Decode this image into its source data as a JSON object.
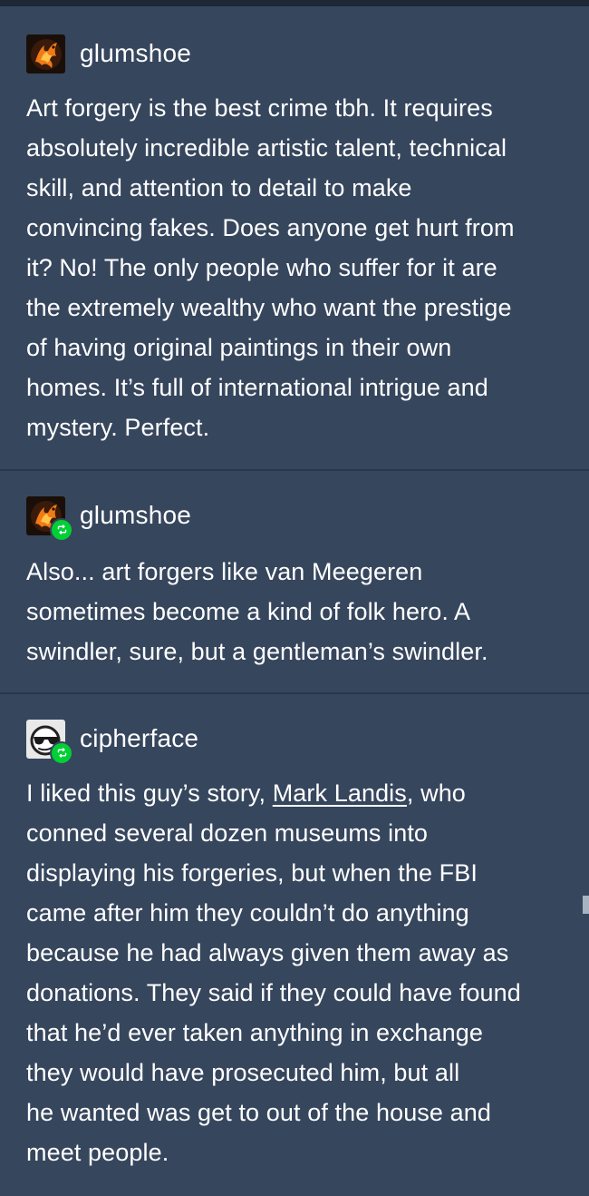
{
  "posts": [
    {
      "username": "glumshoe",
      "is_reblog": false,
      "avatar_icon": "fiery-phoenix-avatar",
      "lines": [
        "Art forgery is the best crime tbh. It requires",
        "absolutely incredible artistic talent, technical",
        "skill, and attention to detail to make",
        "convincing fakes. Does anyone get hurt from",
        "it? No! The only people who suffer for it are",
        "the extremely wealthy who want the prestige",
        "of having original paintings in their own",
        "homes. It’s full of international intrigue and",
        "mystery. Perfect."
      ]
    },
    {
      "username": "glumshoe",
      "is_reblog": true,
      "avatar_icon": "fiery-phoenix-avatar",
      "lines": [
        "Also... art forgers like van Meegeren",
        "sometimes become a kind of folk hero. A",
        "swindler, sure, but a gentleman’s swindler."
      ]
    },
    {
      "username": "cipherface",
      "is_reblog": true,
      "avatar_icon": "sunglasses-face-avatar",
      "lines": {
        "l1_before": "I liked this guy’s story, ",
        "l1_link": "Mark Landis",
        "l1_after": ", who",
        "l2": "conned several dozen museums into",
        "l3": "displaying his forgeries, but when the FBI",
        "l4": "came after him they couldn’t do anything",
        "l5": "because he had always given them away as",
        "l6": "donations. They said if they could have found",
        "l7": "that he’d ever taken anything in exchange",
        "l8": "they would have prosecuted him, but all",
        "l9": "he wanted was get to out of the house and",
        "l10": "meet people."
      }
    }
  ],
  "colors": {
    "background": "#36465d",
    "divider": "#2a3749",
    "reblog_badge": "#00cf35",
    "text": "#ffffff"
  }
}
